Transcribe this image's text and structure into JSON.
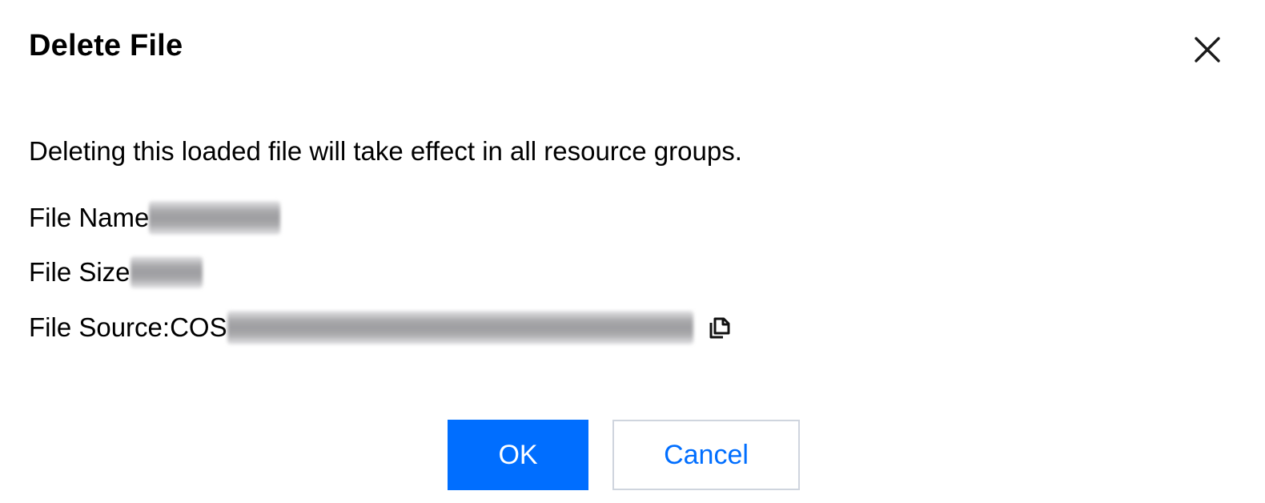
{
  "dialog": {
    "title": "Delete File",
    "message": "Deleting this loaded file will take effect in all resource groups.",
    "file_name_label": "File Name",
    "file_size_label": "File Size",
    "file_source_label": "File Source:COS",
    "ok_label": "OK",
    "cancel_label": "Cancel"
  },
  "icons": {
    "close": "close-icon",
    "copy": "copy-icon"
  },
  "colors": {
    "primary": "#006eff",
    "cancel_border": "#cfd5de",
    "text": "#000000"
  }
}
